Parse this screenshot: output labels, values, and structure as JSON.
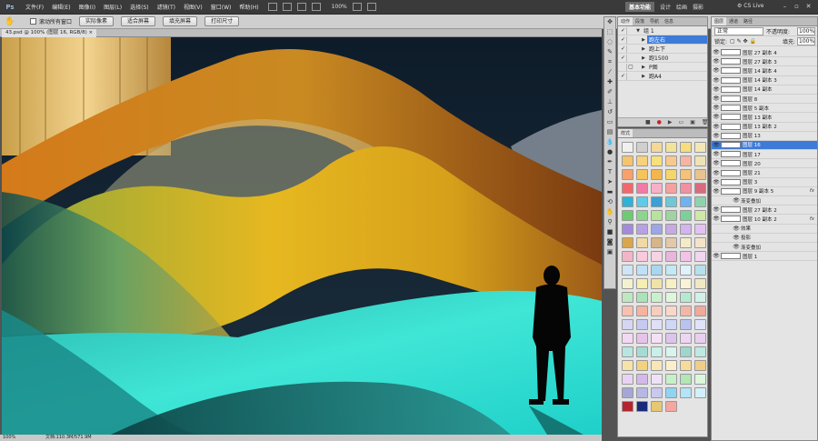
{
  "menubar": {
    "logo": "Ps",
    "menus": [
      "文件(F)",
      "编辑(E)",
      "图像(I)",
      "图层(L)",
      "选择(S)",
      "滤镜(T)",
      "视图(V)",
      "窗口(W)",
      "帮助(H)"
    ],
    "zoom": "100%",
    "workspaces": [
      "基本功能",
      "设计",
      "绘画",
      "摄影"
    ],
    "cs_live": "CS Live"
  },
  "options": {
    "checkbox_label": "滚动所有窗口",
    "buttons": [
      "实际像素",
      "适合屏幕",
      "填充屏幕",
      "打印尺寸"
    ]
  },
  "document": {
    "tab_title": "43.psd @ 100% (图层 16, RGB/8) ×"
  },
  "status": {
    "zoom": "100%",
    "doc_info": "文档:110.3M/571.9M"
  },
  "actions_panel": {
    "tabs": [
      "动作",
      "段落",
      "导航",
      "信息"
    ],
    "rows": [
      {
        "name": "组 1",
        "check": "✓",
        "selected": false
      },
      {
        "name": "跑左右",
        "check": "✓",
        "selected": true
      },
      {
        "name": "跑上下",
        "check": "✓",
        "selected": false
      },
      {
        "name": "跑1500",
        "check": "✓",
        "selected": false
      },
      {
        "name": "P图",
        "check": "",
        "selected": false
      },
      {
        "name": "跑A4",
        "check": "✓",
        "selected": false
      }
    ]
  },
  "styles_panel": {
    "tab": "样式",
    "swatch_colors": [
      "#f0f0f0",
      "#cfcfcf",
      "#f3d89a",
      "#f1e39a",
      "#f7dd7f",
      "#f3e7b6",
      "#f6c46d",
      "#f8d27a",
      "#f6e17d",
      "#f7c98d",
      "#f4b6a2",
      "#efe2b5",
      "#f8a16b",
      "#f7c45a",
      "#f2b64e",
      "#f5d66d",
      "#f4c27a",
      "#e9c38d",
      "#f0686d",
      "#f27aa5",
      "#f6b0c7",
      "#f6a1a0",
      "#f190a3",
      "#d86c7e",
      "#2fb2d6",
      "#5fcbe8",
      "#3aa0d5",
      "#6ec8d8",
      "#70b2f0",
      "#8fd3ae",
      "#6ecb73",
      "#8dd58e",
      "#b7e39e",
      "#9fd3a0",
      "#7fcf9d",
      "#cfe7a7",
      "#a38bdc",
      "#b8a0e6",
      "#9da6e6",
      "#c7a9e3",
      "#d3b3f0",
      "#e3c1f3",
      "#d9a64e",
      "#f0d9a5",
      "#d6b58a",
      "#e3c9a9",
      "#f3eac7",
      "#f5e3c9",
      "#f4b4c8",
      "#f9c9dc",
      "#f7d3e3",
      "#e7b6d9",
      "#f2c3e6",
      "#f1d5f1",
      "#cfe5f5",
      "#bfe0f7",
      "#a9d7ef",
      "#c2e9f4",
      "#dff1fb",
      "#b6e0ed",
      "#f2f2d0",
      "#f5efb0",
      "#efe4a6",
      "#f6f0c2",
      "#f9f4d6",
      "#f0e8c0",
      "#bfe7c1",
      "#a9e3b7",
      "#c9efcb",
      "#dff6da",
      "#b5ead0",
      "#d0f2e6",
      "#f6c1b0",
      "#f5b3a0",
      "#f7cdbf",
      "#f9d8c9",
      "#f2b7a7",
      "#f0a99a",
      "#d6d6f4",
      "#c6c9f2",
      "#e0dff6",
      "#cfd7f7",
      "#bac3f0",
      "#dfe3fa",
      "#f2d8f3",
      "#e7c2ea",
      "#f5e0f5",
      "#dcc4ec",
      "#eed5f3",
      "#e8cff0",
      "#b7e6e0",
      "#a3dcd3",
      "#c9efe9",
      "#d8f4ef",
      "#9fd6cc",
      "#bde9e2",
      "#f7e2a8",
      "#f3d27d",
      "#f8e6b9",
      "#fbefcb",
      "#f6dc98",
      "#f1ce86",
      "#ead3f2",
      "#d5b8ea",
      "#f0e2f6",
      "#c7f0c9",
      "#b2e6b4",
      "#dcf6dc",
      "#a6a6d6",
      "#b7b7e3",
      "#c9c9ee",
      "#8fd4f2",
      "#b3e4f7",
      "#d2f0fb",
      "#b3262f",
      "#1a2a7a",
      "#e6c774",
      "#f4a69f"
    ]
  },
  "layers_panel": {
    "tabs": [
      "图层",
      "通道",
      "路径"
    ],
    "blend_mode": "正常",
    "opacity_label": "不透明度:",
    "opacity": "100%",
    "lock_label": "锁定:",
    "fill_label": "填充:",
    "fill": "100%",
    "layers": [
      {
        "name": "图层 27 副本 4",
        "sub": false,
        "fx": false,
        "selected": false
      },
      {
        "name": "图层 27 副本 3",
        "sub": false,
        "fx": false,
        "selected": false
      },
      {
        "name": "图层 14 副本 4",
        "sub": false,
        "fx": false,
        "selected": false
      },
      {
        "name": "图层 14 副本 3",
        "sub": false,
        "fx": false,
        "selected": false
      },
      {
        "name": "图层 14 副本",
        "sub": false,
        "fx": false,
        "selected": false
      },
      {
        "name": "图层 8",
        "sub": false,
        "fx": false,
        "selected": false
      },
      {
        "name": "图层 5 副本",
        "sub": false,
        "fx": false,
        "selected": false
      },
      {
        "name": "图层 13 副本",
        "sub": false,
        "fx": false,
        "selected": false
      },
      {
        "name": "图层 13 副本 2",
        "sub": false,
        "fx": false,
        "selected": false
      },
      {
        "name": "图层 13",
        "sub": false,
        "fx": false,
        "selected": false
      },
      {
        "name": "图层 16",
        "sub": false,
        "fx": false,
        "selected": true
      },
      {
        "name": "图层 17",
        "sub": false,
        "fx": false,
        "selected": false
      },
      {
        "name": "图层 20",
        "sub": false,
        "fx": false,
        "selected": false
      },
      {
        "name": "图层 21",
        "sub": false,
        "fx": false,
        "selected": false
      },
      {
        "name": "图层 3",
        "sub": false,
        "fx": false,
        "selected": false
      },
      {
        "name": "图层 9 副本 5",
        "sub": false,
        "fx": true,
        "selected": false
      },
      {
        "name": "渐变叠加",
        "sub": true,
        "fx": false,
        "selected": false
      },
      {
        "name": "图层 27 副本 2",
        "sub": false,
        "fx": false,
        "selected": false
      },
      {
        "name": "图层 10 副本 2",
        "sub": false,
        "fx": true,
        "selected": false
      },
      {
        "name": "效果",
        "sub": true,
        "fx": false,
        "selected": false
      },
      {
        "name": "投影",
        "sub": true,
        "fx": false,
        "selected": false
      },
      {
        "name": "渐变叠加",
        "sub": true,
        "fx": false,
        "selected": false
      },
      {
        "name": "图层 1",
        "sub": false,
        "fx": false,
        "selected": false
      }
    ]
  }
}
